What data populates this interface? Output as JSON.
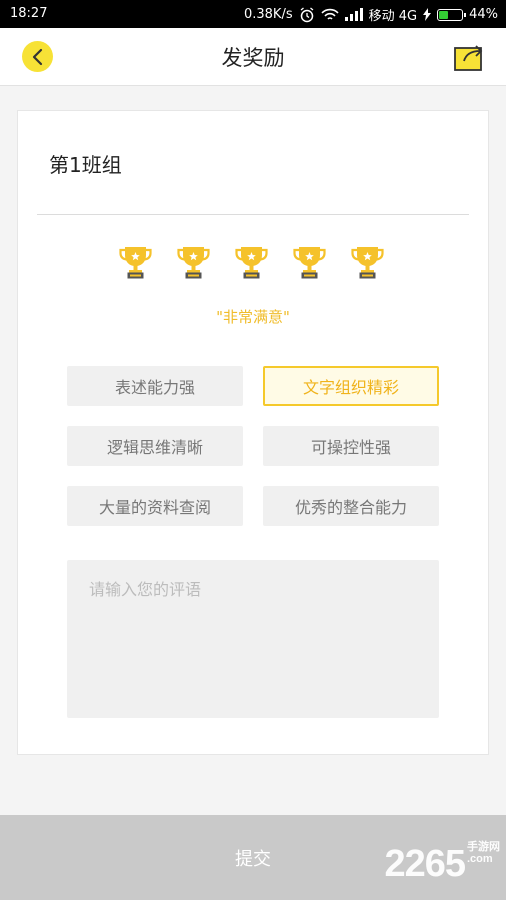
{
  "status_bar": {
    "time": "18:27",
    "speed": "0.38K/s",
    "carrier": "移动 4G",
    "battery": "44%",
    "battery_level": 0.44,
    "battery_color": "#33cc33"
  },
  "header": {
    "title": "发奖励",
    "back_icon": "chevron-left-icon",
    "share_icon": "share-icon",
    "accent": "#f7e236"
  },
  "card": {
    "group_name": "第1班组",
    "trophy_count": 5,
    "rating_text": "\"非常满意\"",
    "rating_color": "#f0bc2a"
  },
  "tags": [
    {
      "label": "表述能力强",
      "selected": false
    },
    {
      "label": "文字组织精彩",
      "selected": true
    },
    {
      "label": "逻辑思维清晰",
      "selected": false
    },
    {
      "label": "可操控性强",
      "selected": false
    },
    {
      "label": "大量的资料查阅",
      "selected": false
    },
    {
      "label": "优秀的整合能力",
      "selected": false
    }
  ],
  "comment": {
    "placeholder": "请输入您的评语",
    "value": ""
  },
  "footer": {
    "submit_label": "提交"
  },
  "watermark": {
    "number": "2265",
    "line1": "手游网",
    "line2": ".com"
  }
}
